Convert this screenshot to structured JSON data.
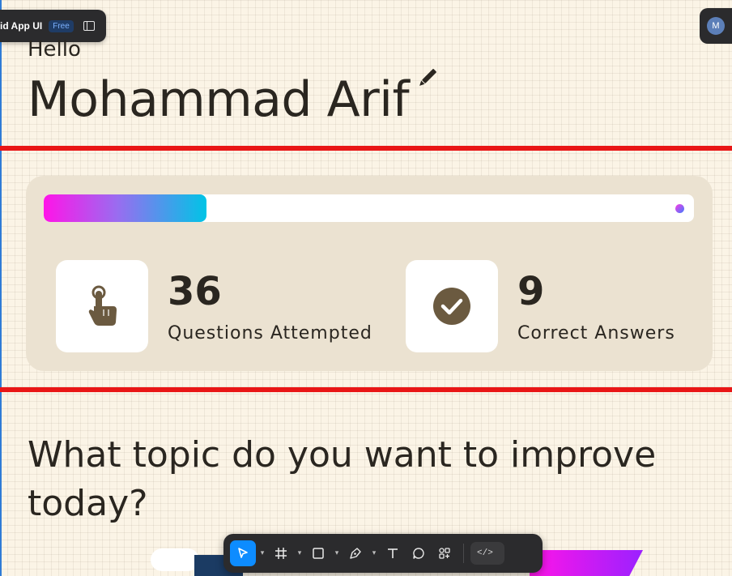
{
  "app": {
    "file_name": "id App UI",
    "plan_badge": "Free",
    "user_initial": "M"
  },
  "header": {
    "greeting": "Hello",
    "user_name": "Mohammad Arif"
  },
  "progress": {
    "fraction": 0.25,
    "fill_colors": [
      "#ff14e8",
      "#9a6cf0",
      "#00c4e6"
    ]
  },
  "stats": [
    {
      "icon": "tap-finger-icon",
      "value": "36",
      "label": "Questions Attempted"
    },
    {
      "icon": "check-circle-icon",
      "value": "9",
      "label": "Correct Answers"
    }
  ],
  "prompt": {
    "question": "What topic do you want to improve today?"
  },
  "toolbar": {
    "tools": [
      "move-tool",
      "frame-tool",
      "shape-tool",
      "pen-tool",
      "text-tool",
      "comment-tool",
      "actions-tool"
    ],
    "dev_mode_label": "</>"
  },
  "colors": {
    "background": "#fbf4e6",
    "card": "#ebe2d1",
    "guide": "#e91616",
    "accent": "#0d8cff",
    "icon": "#6b5a40"
  }
}
